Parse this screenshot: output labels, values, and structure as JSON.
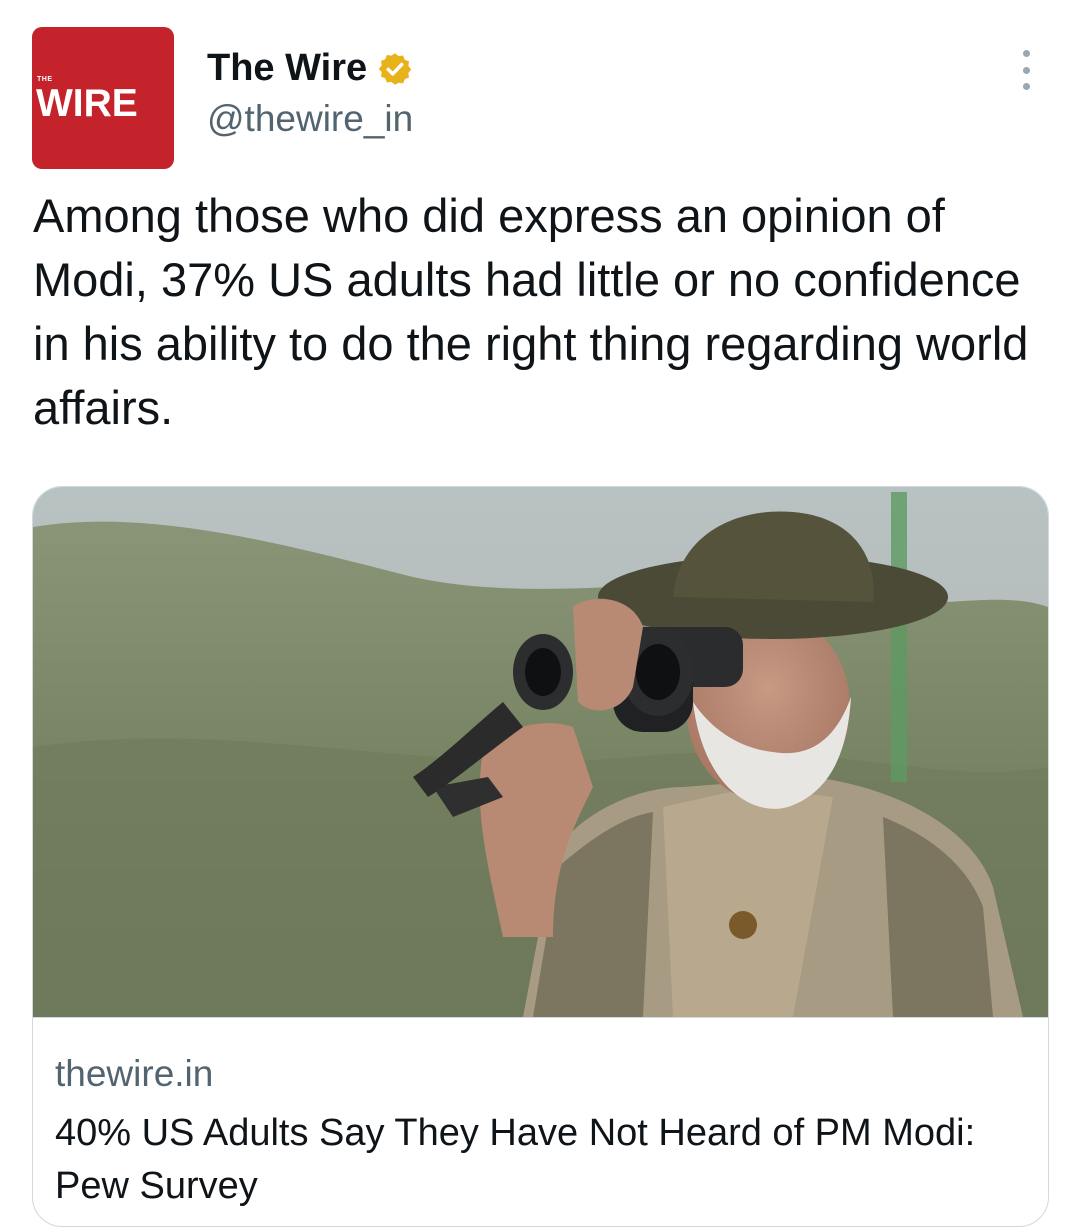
{
  "account": {
    "avatar_small_text": "THE",
    "avatar_text": "WIRE",
    "name": "The Wire",
    "handle": "@thewire_in",
    "verified_badge": "verified-badge-icon",
    "brand_color": "#c4232b",
    "verified_color": "#e8b21a"
  },
  "menu": {
    "icon": "more-vertical-icon"
  },
  "tweet": {
    "text": "Among those who did express an opinion of Modi, 37% US adults had little or no confidence in his ability to do the right thing regarding world affairs."
  },
  "link_card": {
    "domain": "thewire.in",
    "title": "40% US Adults Say They Have Not Heard of PM Modi: Pew Survey"
  }
}
